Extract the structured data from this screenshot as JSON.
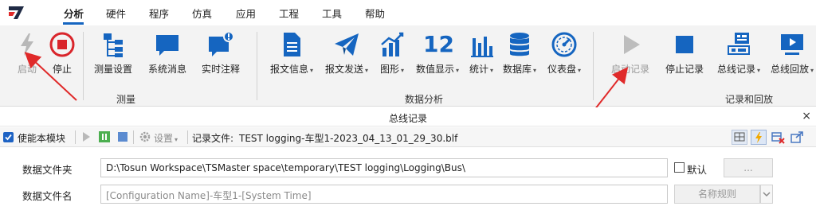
{
  "menu": {
    "items": [
      "分析",
      "硬件",
      "程序",
      "仿真",
      "应用",
      "工程",
      "工具",
      "帮助"
    ],
    "active": "分析"
  },
  "ribbon": {
    "groups": {
      "measurement": "测量",
      "data_analysis": "数据分析",
      "record_replay": "记录和回放"
    },
    "buttons": {
      "start": "启动",
      "stop": "停止",
      "measure_setup": "测量设置",
      "system_messages": "系统消息",
      "realtime_notes": "实时注释",
      "msg_info": "报文信息",
      "msg_send": "报文发送",
      "graphics": "图形",
      "numeric_display": "数值显示",
      "numeric_icon_text": "12",
      "statistics": "统计",
      "database": "数据库",
      "gauge": "仪表盘",
      "start_record": "启动记录",
      "stop_record": "停止记录",
      "bus_record": "总线记录",
      "bus_replay": "总线回放"
    },
    "colors": {
      "accent": "#1565c0",
      "stop_red": "#d9252b",
      "disabled": "#b0b0b0"
    }
  },
  "panel": {
    "title": "总线记录",
    "close": "×",
    "toolbar": {
      "enable_module": "使能本模块",
      "settings": "设置",
      "record_file_label": "记录文件:",
      "record_file_name": "TEST logging-车型1-2023_04_13_01_29_30.blf"
    },
    "form": {
      "data_folder_label": "数据文件夹",
      "data_folder_value": "D:\\Tosun Workspace\\TSMaster space\\temporary\\TEST logging\\Logging\\Bus\\",
      "default_label": "默认",
      "browse_label": "...",
      "data_filename_label": "数据文件名",
      "data_filename_placeholder": "[Configuration Name]-车型1-[System Time]",
      "naming_rule_label": "名称规则"
    }
  }
}
